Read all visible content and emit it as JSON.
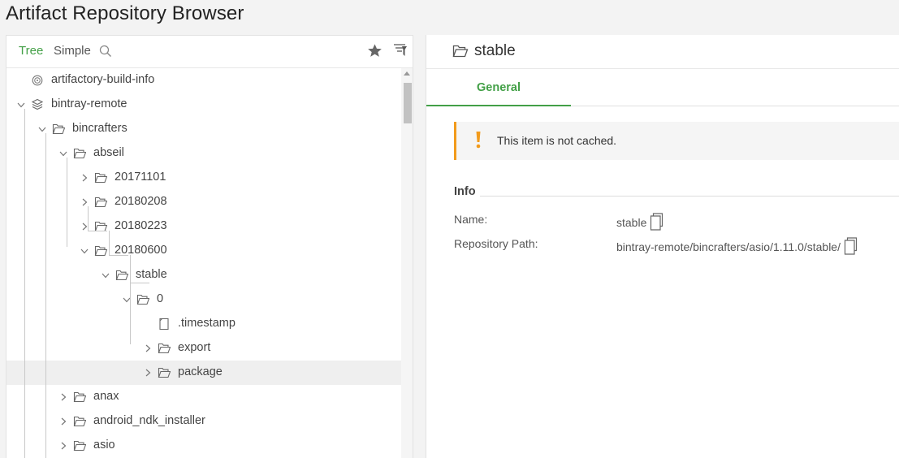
{
  "app": {
    "title": "Artifact Repository Browser"
  },
  "tree_toolbar": {
    "tree_label": "Tree",
    "simple_label": "Simple"
  },
  "tree": [
    {
      "label": "artifactory-build-info",
      "icon": "build-info-icon",
      "expander": "none"
    },
    {
      "label": "bintray-remote",
      "icon": "remote-repo-icon",
      "expander": "expanded"
    },
    {
      "label": "bincrafters",
      "icon": "folder-icon",
      "expander": "expanded"
    },
    {
      "label": "abseil",
      "icon": "folder-icon",
      "expander": "expanded"
    },
    {
      "label": "20171101",
      "icon": "folder-icon",
      "expander": "collapsed"
    },
    {
      "label": "20180208",
      "icon": "folder-icon",
      "expander": "collapsed"
    },
    {
      "label": "20180223",
      "icon": "folder-icon",
      "expander": "collapsed"
    },
    {
      "label": "20180600",
      "icon": "folder-icon",
      "expander": "expanded"
    },
    {
      "label": "stable",
      "icon": "folder-icon",
      "expander": "expanded"
    },
    {
      "label": "0",
      "icon": "folder-icon",
      "expander": "expanded"
    },
    {
      "label": ".timestamp",
      "icon": "file-icon",
      "expander": "none"
    },
    {
      "label": "export",
      "icon": "folder-icon",
      "expander": "collapsed"
    },
    {
      "label": "package",
      "icon": "folder-icon",
      "expander": "collapsed",
      "selected": true
    },
    {
      "label": "anax",
      "icon": "folder-icon",
      "expander": "collapsed"
    },
    {
      "label": "android_ndk_installer",
      "icon": "folder-icon",
      "expander": "collapsed"
    },
    {
      "label": "asio",
      "icon": "folder-icon",
      "expander": "collapsed"
    }
  ],
  "detail": {
    "title": "stable",
    "tabs": [
      {
        "label": "General",
        "active": true
      }
    ],
    "notice": "This item is not cached.",
    "info_title": "Info",
    "info": [
      {
        "key": "Name:",
        "value": "stable"
      },
      {
        "key": "Repository Path:",
        "value": "bintray-remote/bincrafters/asio/1.11.0/stable/"
      }
    ]
  },
  "colors": {
    "accent": "#43a047",
    "warning": "#f29b1c",
    "selected_row": "#efefef"
  }
}
